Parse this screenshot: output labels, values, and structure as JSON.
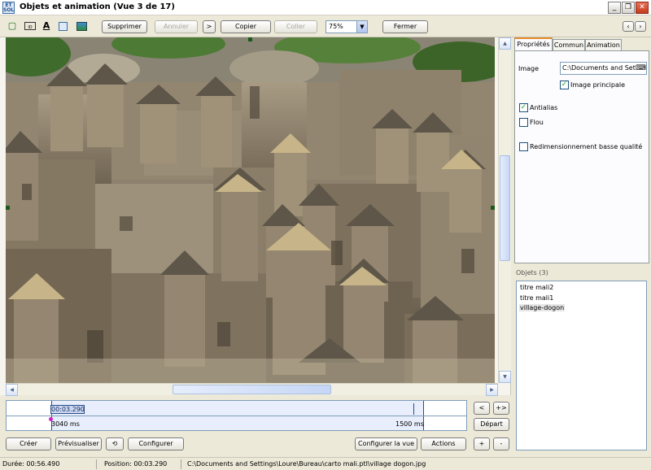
{
  "window": {
    "title": "Objets et animation  (Vue 3 de 17)",
    "app_icon_text": "ET SOL",
    "controls": [
      "minimize-icon",
      "maximize-icon",
      "close-icon"
    ]
  },
  "toolbar": {
    "tools": [
      {
        "name": "frame-icon",
        "glyph": "▢"
      },
      {
        "name": "image-tool-icon",
        "glyph": "ID"
      },
      {
        "name": "text-tool-icon",
        "glyph": "A"
      },
      {
        "name": "rectangle-tool-icon",
        "glyph": "□"
      },
      {
        "name": "picture-tool-icon",
        "glyph": "▣"
      }
    ],
    "delete_label": "Supprimer",
    "undo_label": "Annuler",
    "redo_label": ">",
    "copy_label": "Copier",
    "paste_label": "Coller",
    "zoom_value": "75%",
    "close_label": "Fermer"
  },
  "tabs": [
    "Propriétés",
    "Commun",
    "Animation"
  ],
  "properties": {
    "image_label": "Image",
    "image_path": "C:\\Documents and Sett",
    "main_image_label": "Image principale",
    "main_image_checked": true,
    "antialias_label": "Antialias",
    "antialias_checked": true,
    "blur_label": "Flou",
    "blur_checked": false,
    "lowres_label": "Redimensionnement basse qualité",
    "lowres_checked": false
  },
  "objects": {
    "title": "Objets (3)",
    "items": [
      "titre mali2",
      "titre mali1",
      "village-dogon"
    ],
    "selected_index": 2
  },
  "timeline": {
    "current_time": "00:03.290",
    "start_label": "3040 ms",
    "end_label": "1500 ms",
    "prev_label": "<",
    "next_label": "+>",
    "start_button_label": "Départ"
  },
  "bottom_buttons": {
    "create_label": "Créer",
    "preview_label": "Prévisualiser",
    "configure_label": "Configurer",
    "configure_view_label": "Configurer la vue",
    "actions_label": "Actions",
    "plus_label": "+",
    "minus_label": "-"
  },
  "status": {
    "duration": "Durée:  00:56.490",
    "position": "Position:  00:03.290",
    "file_path": "C:\\Documents and Settings\\Loure\\Bureau\\carto mali.ptl\\village dogon.jpg"
  },
  "colors": {
    "face": "#ece9d8",
    "accent_tab": "#e68b2c",
    "timeline_blue": "#274b8c",
    "check_green": "#21a121"
  }
}
